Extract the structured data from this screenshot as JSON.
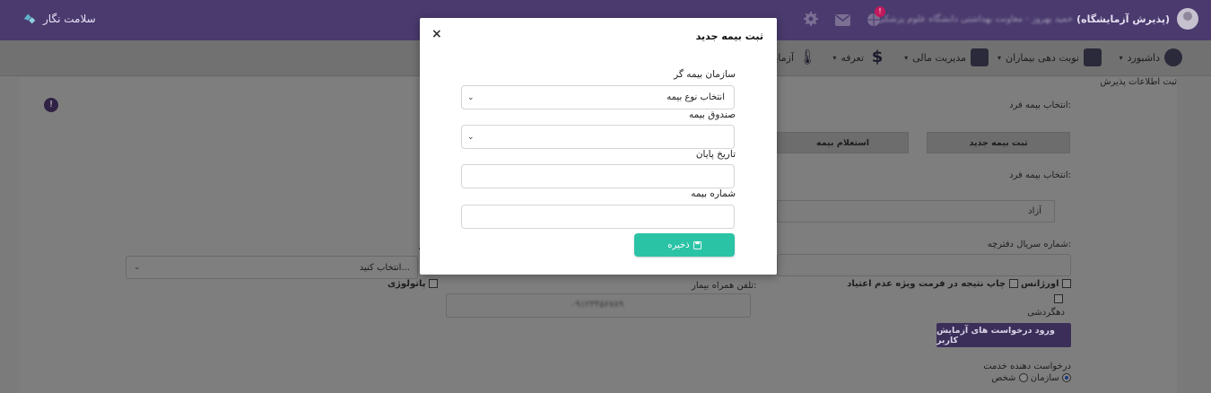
{
  "app": {
    "brand_name": "سلامت نگار"
  },
  "topbar": {
    "user_name": "(پذیرش آزمایشگاه)",
    "user_info_blurred": "حمید بهروز - معاونت بهداشتی دانشگاه علوم پزشکی",
    "notification_count": "!"
  },
  "nav": {
    "items": [
      {
        "label": "داشبورد",
        "icon": "dashboard-icon"
      },
      {
        "label": "نوبت دهی بیماران",
        "icon": "grid-icon"
      },
      {
        "label": "مدیریت مالی",
        "icon": "credit-card-icon"
      },
      {
        "label": "تعرفه",
        "icon": "dollar-icon"
      },
      {
        "label": "آزمایش",
        "icon": "thermometer-icon"
      }
    ]
  },
  "page": {
    "reception_title": "ثبت اطلاعات پذیرش",
    "select_insurance_label_1": "انتخاب بیمه فرد:",
    "register_new_insurance_button": "ثبت بیمه جدید",
    "insurance_inquiry_button": "استعلام بیمه",
    "select_insurance_label_2": "انتخاب بیمه فرد:",
    "insurance_value": "آزاد",
    "notebook_serial_label": "شماره سریال دفترچه:",
    "left_select_placeholder": "انتخاب کنید...",
    "pathology_label": "پاتولوژی",
    "patient_companion_phone_label": "تلفن همراه بیمار:",
    "patient_phone_blurred": "۰۹۱۲۳۴۵۶۷۸۹",
    "print_invalid_format_label": "چاپ نتیجه در فرمت ویژه عدم اعتیاد",
    "urgent_label": "اورژانس",
    "transgender_label": "دهگردشی",
    "user_test_requests_button": "ورود درخواست های آزمایش کاربر",
    "service_requester_label": "درخواست دهنده خدمت",
    "requester_person_label": "شخص",
    "requester_org_label": "سازمان"
  },
  "modal": {
    "title": "ثبت بیمه جدید",
    "close_symbol": "×",
    "insurer_org_label": "سازمان بیمه گر",
    "insurer_org_value": "انتخاب نوع بیمه",
    "insurance_fund_label": "صندوق بیمه",
    "insurance_fund_value": "",
    "end_date_label": "تاریخ پایان",
    "end_date_value": "",
    "insurance_number_label": "شماره بیمه",
    "insurance_number_value": "",
    "save_button": "ذخیره"
  },
  "colors": {
    "topbar_bg": "#4a3a6e",
    "save_button": "#2bc3a6",
    "purple_button": "#3b2f5a",
    "overlay_dim": "#7b7b7b"
  }
}
